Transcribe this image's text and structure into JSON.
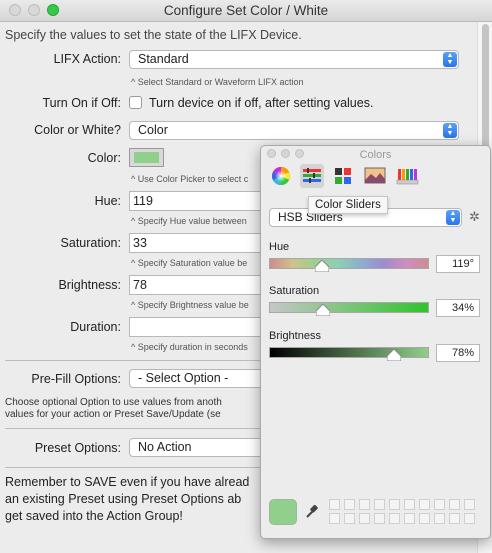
{
  "window": {
    "title": "Configure Set Color / White"
  },
  "intro": "Specify the values to set the state of the LIFX Device.",
  "lifx_action": {
    "label": "LIFX Action:",
    "value": "Standard",
    "hint": "^ Select Standard or Waveform LIFX action"
  },
  "turn_on": {
    "label": "Turn On if Off:",
    "checkbox_label": "Turn device on if off, after setting values.",
    "checked": false
  },
  "color_or_white": {
    "label": "Color or White?",
    "value": "Color"
  },
  "color": {
    "label": "Color:",
    "swatch": "#90cf8c",
    "hint": "^ Use Color Picker to select c"
  },
  "hue": {
    "label": "Hue:",
    "value": "119",
    "hint": "^ Specify Hue value between"
  },
  "saturation": {
    "label": "Saturation:",
    "value": "33",
    "hint": "^ Specify Saturation value be"
  },
  "brightness": {
    "label": "Brightness:",
    "value": "78",
    "hint": "^ Specify Brightness value be"
  },
  "duration": {
    "label": "Duration:",
    "value": "",
    "hint": "^ Specify duration in seconds"
  },
  "prefill": {
    "label": "Pre-Fill Options:",
    "value": "- Select Option -",
    "desc_line1": "Choose optional Option to use values from anoth",
    "desc_line2": "values for your action or Preset Save/Update (se"
  },
  "preset": {
    "label": "Preset Options:",
    "value": "No Action"
  },
  "bottom": {
    "line1": "Remember to SAVE even if you have alread",
    "line2": "an existing Preset using Preset Options ab",
    "line3": "get saved into the Action Group!"
  },
  "colors_panel": {
    "title": "Colors",
    "tooltip": "Color Sliders",
    "mode": "HSB Sliders",
    "hue": {
      "label": "Hue",
      "value": "119°",
      "level": 0.331
    },
    "saturation": {
      "label": "Saturation",
      "value": "34%",
      "level": 0.34
    },
    "brightness": {
      "label": "Brightness",
      "value": "78%",
      "level": 0.78
    },
    "current_color": "#90cf8c"
  }
}
